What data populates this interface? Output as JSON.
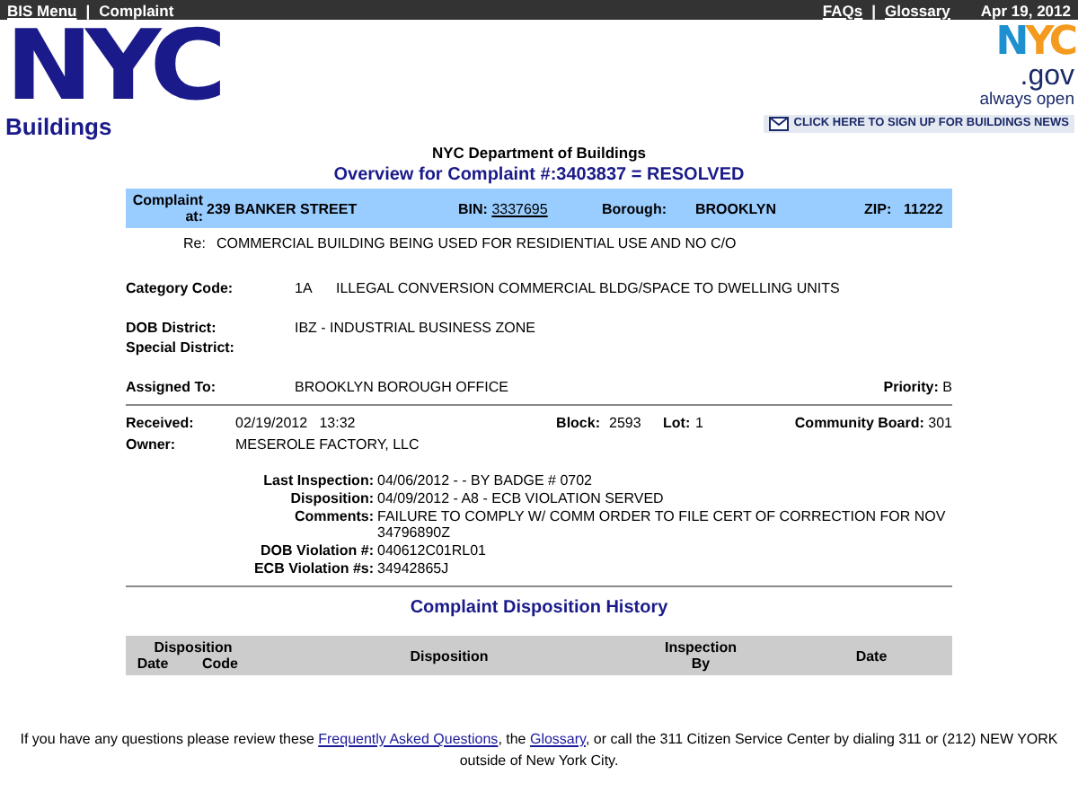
{
  "top_bar": {
    "left": [
      {
        "kind": "link",
        "label": "BIS Menu"
      },
      {
        "kind": "separator",
        "label": "|"
      },
      {
        "kind": "text",
        "label": "Complaint"
      }
    ],
    "right": [
      {
        "kind": "link",
        "label": "FAQs"
      },
      {
        "kind": "separator",
        "label": "|"
      },
      {
        "kind": "link",
        "label": "Glossary"
      },
      {
        "kind": "text",
        "label": "Apr 19, 2012"
      }
    ]
  },
  "header": {
    "logo_mark": "NYC",
    "logo_text": "Buildings",
    "gov_logo": {
      "mark": "NYC",
      "domain": ".gov",
      "tagline": "always open"
    },
    "newsletter_link": "CLICK HERE TO SIGN UP FOR BUILDINGS NEWS"
  },
  "department": "NYC Department of Buildings",
  "overview_title": "Overview for Complaint #:3403837 = RESOLVED",
  "location_band": {
    "label": "Complaint at:",
    "address": "239 BANKER STREET",
    "bin_label": "BIN:",
    "bin": "3337695",
    "borough_label": "Borough:",
    "borough": "BROOKLYN",
    "zip_label": "ZIP:",
    "zip": "11222"
  },
  "re": {
    "label": "Re:",
    "value": "COMMERCIAL BUILDING BEING USED FOR RESIDIENTIAL USE AND NO C/O"
  },
  "category": {
    "label": "Category Code:",
    "code": "1A",
    "description": "ILLEGAL CONVERSION COMMERCIAL BLDG/SPACE TO DWELLING UNITS"
  },
  "dob_district": {
    "label": "DOB District:",
    "value": "IBZ - INDUSTRIAL BUSINESS ZONE"
  },
  "special_district": {
    "label": "Special District:"
  },
  "assigned": {
    "label": "Assigned To:",
    "value": "BROOKLYN BOROUGH OFFICE",
    "priority_label": "Priority:",
    "priority": "B"
  },
  "received": {
    "label": "Received:",
    "date": "02/19/2012",
    "time": "13:32",
    "block_label": "Block:",
    "block": "2593",
    "lot_label": "Lot:",
    "lot": "1",
    "board_label": "Community Board:",
    "board": "301"
  },
  "owner": {
    "label": "Owner:",
    "value": "MESEROLE FACTORY, LLC"
  },
  "inspection": [
    {
      "label": "Last Inspection:",
      "value": "04/06/2012 - - BY BADGE # 0702"
    },
    {
      "label": "Disposition:",
      "value": "04/09/2012 - A8 - ECB VIOLATION SERVED"
    },
    {
      "label": "Comments:",
      "value": "FAILURE TO COMPLY W/ COMM ORDER TO FILE CERT OF CORRECTION FOR NOV 34796890Z"
    },
    {
      "label": "DOB Violation #:",
      "value": "040612C01RL01"
    },
    {
      "label": "ECB Violation #s:",
      "value": "34942865J"
    }
  ],
  "history": {
    "title": "Complaint Disposition History",
    "columns": [
      {
        "label": "Disposition",
        "sub": [
          "Date",
          "Code"
        ]
      },
      {
        "label": "Disposition"
      },
      {
        "label": "Inspection By"
      },
      {
        "label": "Date"
      }
    ]
  },
  "footer": [
    {
      "kind": "text",
      "text": "If you have any questions please review these "
    },
    {
      "kind": "link",
      "text": "Frequently Asked Questions"
    },
    {
      "kind": "text",
      "text": ", the "
    },
    {
      "kind": "link",
      "text": "Glossary"
    },
    {
      "kind": "text",
      "text": ", or call the 311 Citizen Service Center by dialing 311 or (212) NEW YORK outside of New York City."
    }
  ]
}
